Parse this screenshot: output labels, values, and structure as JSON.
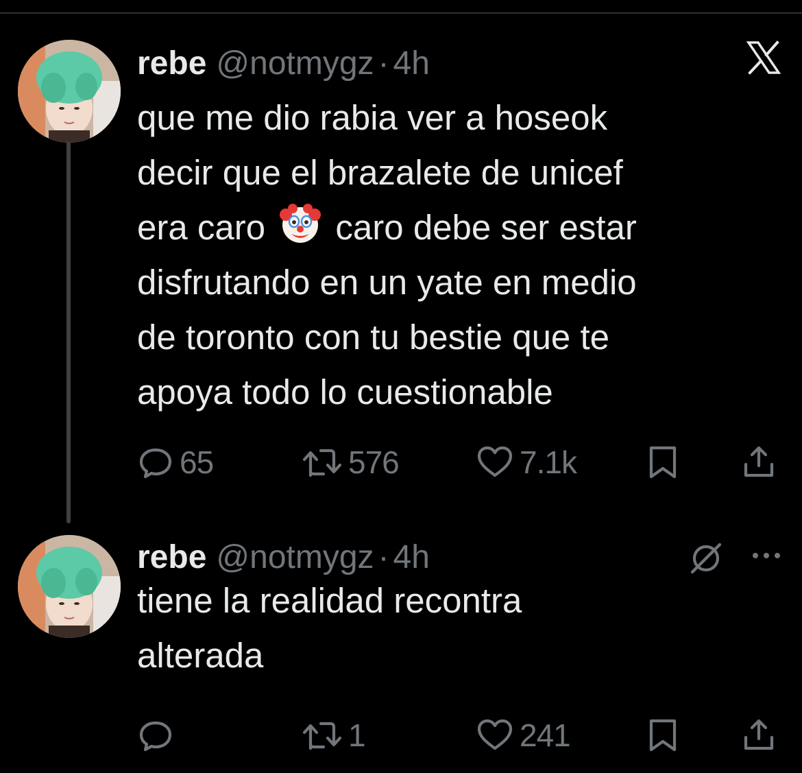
{
  "thread": [
    {
      "display_name": "rebe",
      "handle": "@notmygz",
      "separator": "·",
      "time": "4h",
      "text_before_emoji": "que me dio rabia ver a hoseok\ndecir que el brazalete de unicef\nera caro ",
      "emoji": "clown-face",
      "text_after_emoji": " caro debe ser estar\ndisfrutando en un yate en medio\nde toronto con tu bestie que te\napoya todo lo cuestionable",
      "reply_count": "65",
      "retweet_count": "576",
      "like_count": "7.1k",
      "corner_icon": "x-logo-icon"
    },
    {
      "display_name": "rebe",
      "handle": "@notmygz",
      "separator": "·",
      "time": "4h",
      "text": "tiene la realidad recontra\nalterada",
      "reply_count": "",
      "retweet_count": "1",
      "like_count": "241",
      "corner_icons": [
        "hide-reply-icon",
        "more-icon"
      ]
    }
  ],
  "colors": {
    "background": "#000000",
    "primary_text": "#e7e9ea",
    "secondary_text": "#71767b",
    "thread_line": "#3e4144",
    "avatar_hair": "#4fc3a1"
  }
}
